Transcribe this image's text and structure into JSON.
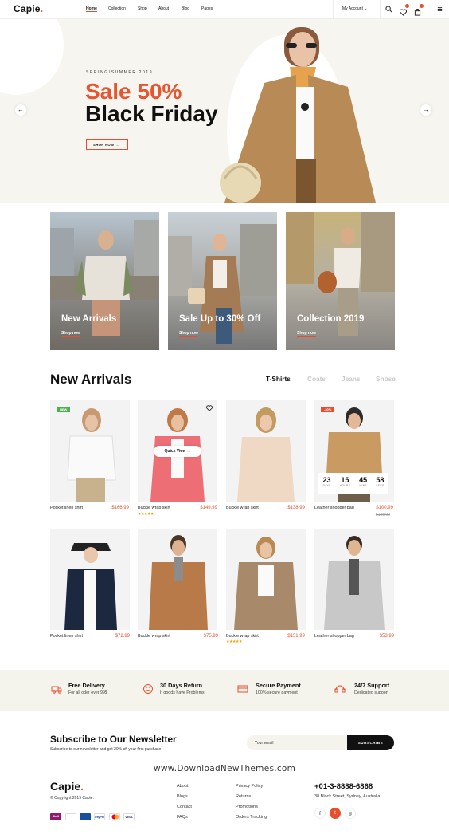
{
  "header": {
    "logo": "Capie",
    "nav": [
      "Home",
      "Collection",
      "Shop",
      "About",
      "Blog",
      "Pages"
    ],
    "account": "My Account"
  },
  "hero": {
    "season": "SPRING/SUMMER 2019",
    "line1": "Sale 50%",
    "line2": "Black Friday",
    "cta": "SHOP NOW"
  },
  "cards": [
    {
      "title": "New Arrivals",
      "link": "Shop now"
    },
    {
      "title": "Sale Up to 30% Off",
      "link": "Shop now"
    },
    {
      "title": "Collection 2019",
      "link": "Shop now"
    }
  ],
  "new_arrivals": {
    "title": "New Arrivals",
    "tabs": [
      "T-Shirts",
      "Coats",
      "Jeans",
      "Shose"
    ]
  },
  "products": [
    {
      "name": "Pocket linen shirt",
      "price": "$166.99",
      "badge": "NEW"
    },
    {
      "name": "Buckle wrap skirt",
      "price": "$149.99",
      "quick": "Quick View"
    },
    {
      "name": "Buckle wrap skirt",
      "price": "$138.99"
    },
    {
      "name": "Leather shopper bag",
      "price": "$100.99",
      "old": "$138.99",
      "badge": "-30%"
    },
    {
      "name": "Pocket linen shirt",
      "price": "$72.99"
    },
    {
      "name": "Buckle wrap skirt",
      "price": "$75.99"
    },
    {
      "name": "Buckle wrap skirt",
      "price": "$151.99"
    },
    {
      "name": "Leather shopper bag",
      "price": "$53.99"
    }
  ],
  "timer": [
    {
      "n": "23",
      "l": "DAYS"
    },
    {
      "n": "15",
      "l": "HOURS"
    },
    {
      "n": "45",
      "l": "MINS"
    },
    {
      "n": "58",
      "l": "SECS"
    }
  ],
  "features": [
    {
      "title": "Free Delivery",
      "sub": "For all oder over 99$"
    },
    {
      "title": "30 Days Return",
      "sub": "If goods have Problems"
    },
    {
      "title": "Secure Payment",
      "sub": "100% secure payment"
    },
    {
      "title": "24/7 Support",
      "sub": "Dedicated support"
    }
  ],
  "newsletter": {
    "title": "Subscribe to Our Newsletter",
    "sub": "Subscribe to our newsletter and get 20% off your first purchase",
    "placeholder": "Your email",
    "button": "SUBSCRIBE"
  },
  "watermark": "www.DownloadNewThemes.com",
  "footer": {
    "logo": "Capie",
    "copyright": "© Copyright 2019 Capie.",
    "col1": [
      "About",
      "Blogs",
      "Contact",
      "FAQs"
    ],
    "col2": [
      "Privacy Policy",
      "Returns",
      "Promotions",
      "Orders Tracking"
    ],
    "phone": "+01-3-8888-6868",
    "address": "38 Block Street, Sydney, Australia",
    "payments": [
      "Skrill",
      "Discover",
      "Visa Electron",
      "PayPal",
      "MasterCard",
      "VISA"
    ]
  },
  "colors": {
    "accent": "#e84e2e",
    "cream": "#f5f4ec"
  }
}
